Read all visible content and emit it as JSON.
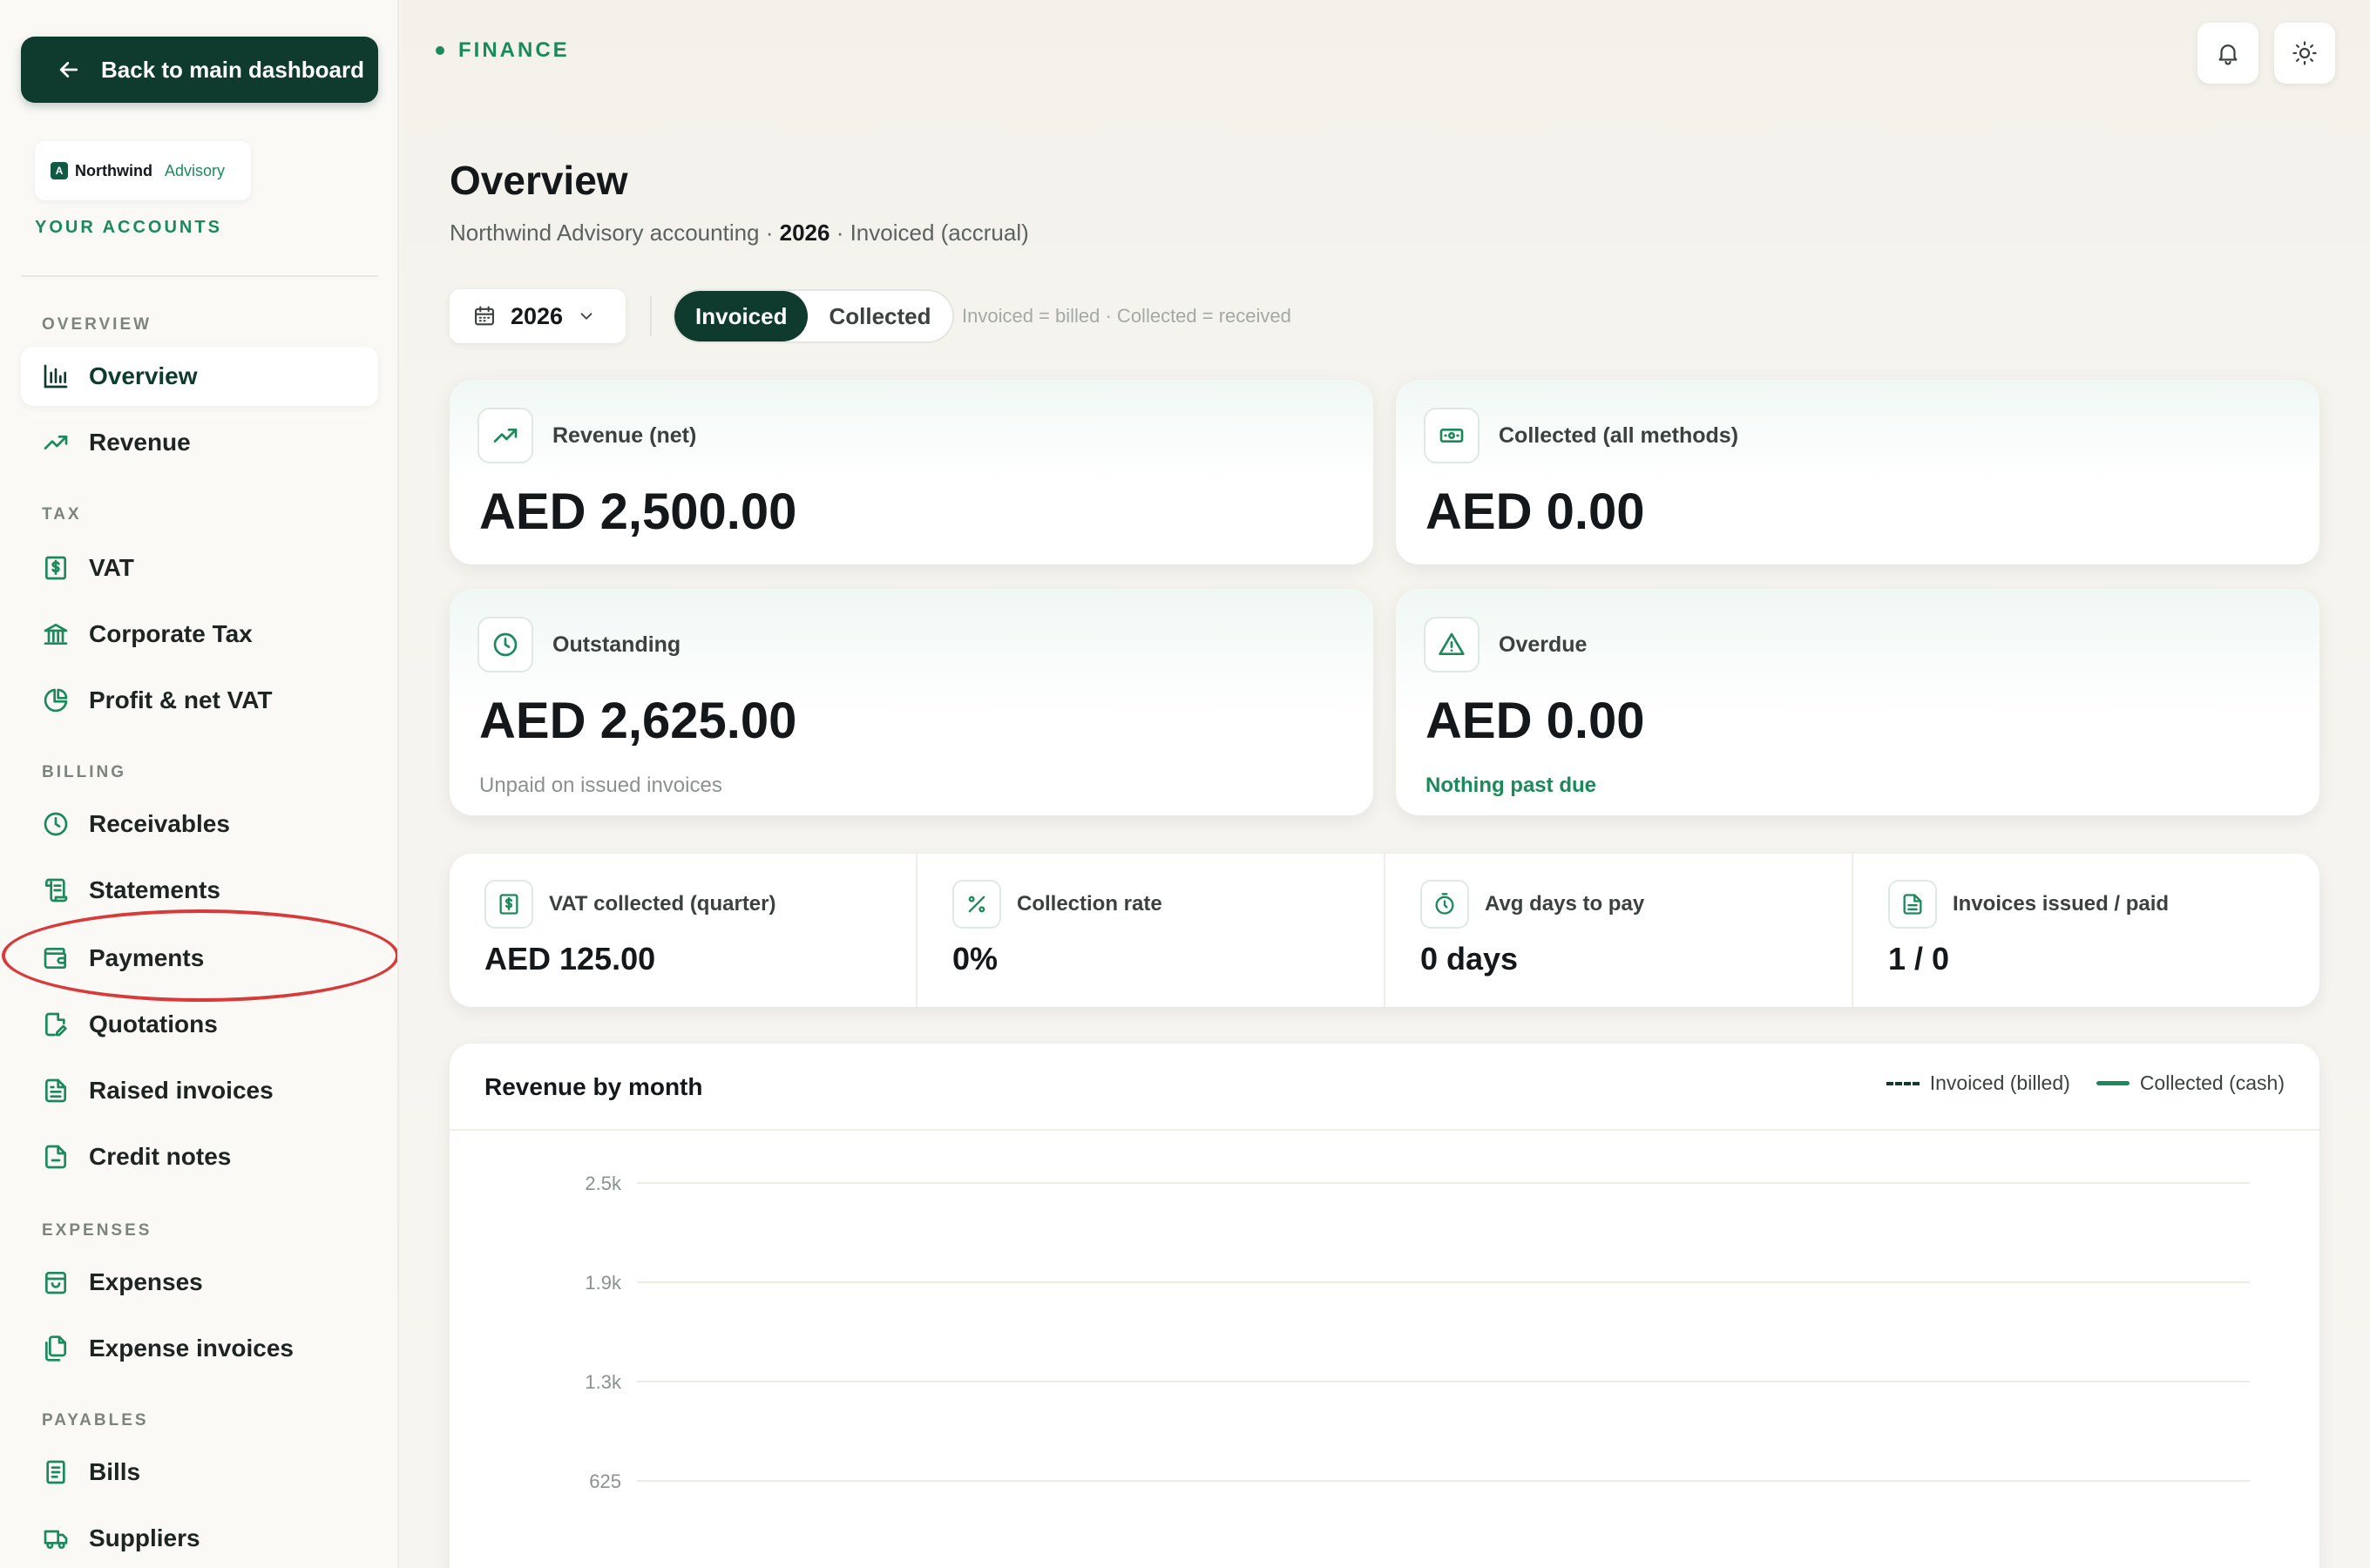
{
  "sidebar": {
    "back_label": "Back to main dashboard",
    "brand": {
      "mark": "A",
      "name": "Northwind",
      "sub": "Advisory"
    },
    "accounts_label": "YOUR ACCOUNTS",
    "sections": {
      "overview": "OVERVIEW",
      "tax": "TAX",
      "billing": "BILLING",
      "expenses": "EXPENSES",
      "payables": "PAYABLES"
    },
    "items": {
      "overview": "Overview",
      "revenue": "Revenue",
      "vat": "VAT",
      "corporate_tax": "Corporate Tax",
      "profit_net_vat": "Profit & net VAT",
      "receivables": "Receivables",
      "statements": "Statements",
      "payments": "Payments",
      "quotations": "Quotations",
      "raised_invoices": "Raised invoices",
      "credit_notes": "Credit notes",
      "expenses": "Expenses",
      "expense_invoices": "Expense invoices",
      "bills": "Bills",
      "suppliers": "Suppliers"
    },
    "active_item": "overview"
  },
  "header": {
    "crumb": "FINANCE",
    "title": "Overview",
    "subtitle_prefix": "Northwind Advisory accounting · ",
    "subtitle_year": "2026",
    "subtitle_suffix": " · Invoiced (accrual)"
  },
  "toolbar": {
    "year": "2026",
    "mode_invoiced": "Invoiced",
    "mode_collected": "Collected",
    "active_mode": "Invoiced",
    "hint": "Invoiced = billed · Collected = received"
  },
  "cards": {
    "revenue": {
      "label": "Revenue (net)",
      "value": "AED 2,500.00"
    },
    "collected": {
      "label": "Collected (all methods)",
      "value": "AED 0.00"
    },
    "outstanding": {
      "label": "Outstanding",
      "value": "AED 2,625.00",
      "note": "Unpaid on issued invoices"
    },
    "overdue": {
      "label": "Overdue",
      "value": "AED 0.00",
      "note": "Nothing past due"
    }
  },
  "stats": {
    "vat": {
      "label": "VAT collected (quarter)",
      "value": "AED 125.00"
    },
    "rate": {
      "label": "Collection rate",
      "value": "0%"
    },
    "days": {
      "label": "Avg days to pay",
      "value": "0 days"
    },
    "invoices": {
      "label": "Invoices issued / paid",
      "value": "1 / 0"
    }
  },
  "chart_data": {
    "type": "line",
    "title": "Revenue by month",
    "series": [
      {
        "name": "Invoiced (billed)",
        "style": "dashed",
        "color": "#0f3b2e"
      },
      {
        "name": "Collected (cash)",
        "style": "solid",
        "color": "#1b8a5a"
      }
    ],
    "y_ticks": [
      "2.5k",
      "1.9k",
      "1.3k",
      "625"
    ],
    "y_tick_values": [
      2500,
      1875,
      1250,
      625
    ],
    "grid": true,
    "legend_position": "top-right"
  },
  "colors": {
    "accent": "#0f3b2e",
    "brand_green": "#1b8a5a",
    "annotation": "#d83a3a"
  },
  "icons": {
    "back": "arrow-left-icon",
    "bell": "bell-icon",
    "theme": "sun-icon",
    "calendar": "calendar-icon"
  }
}
